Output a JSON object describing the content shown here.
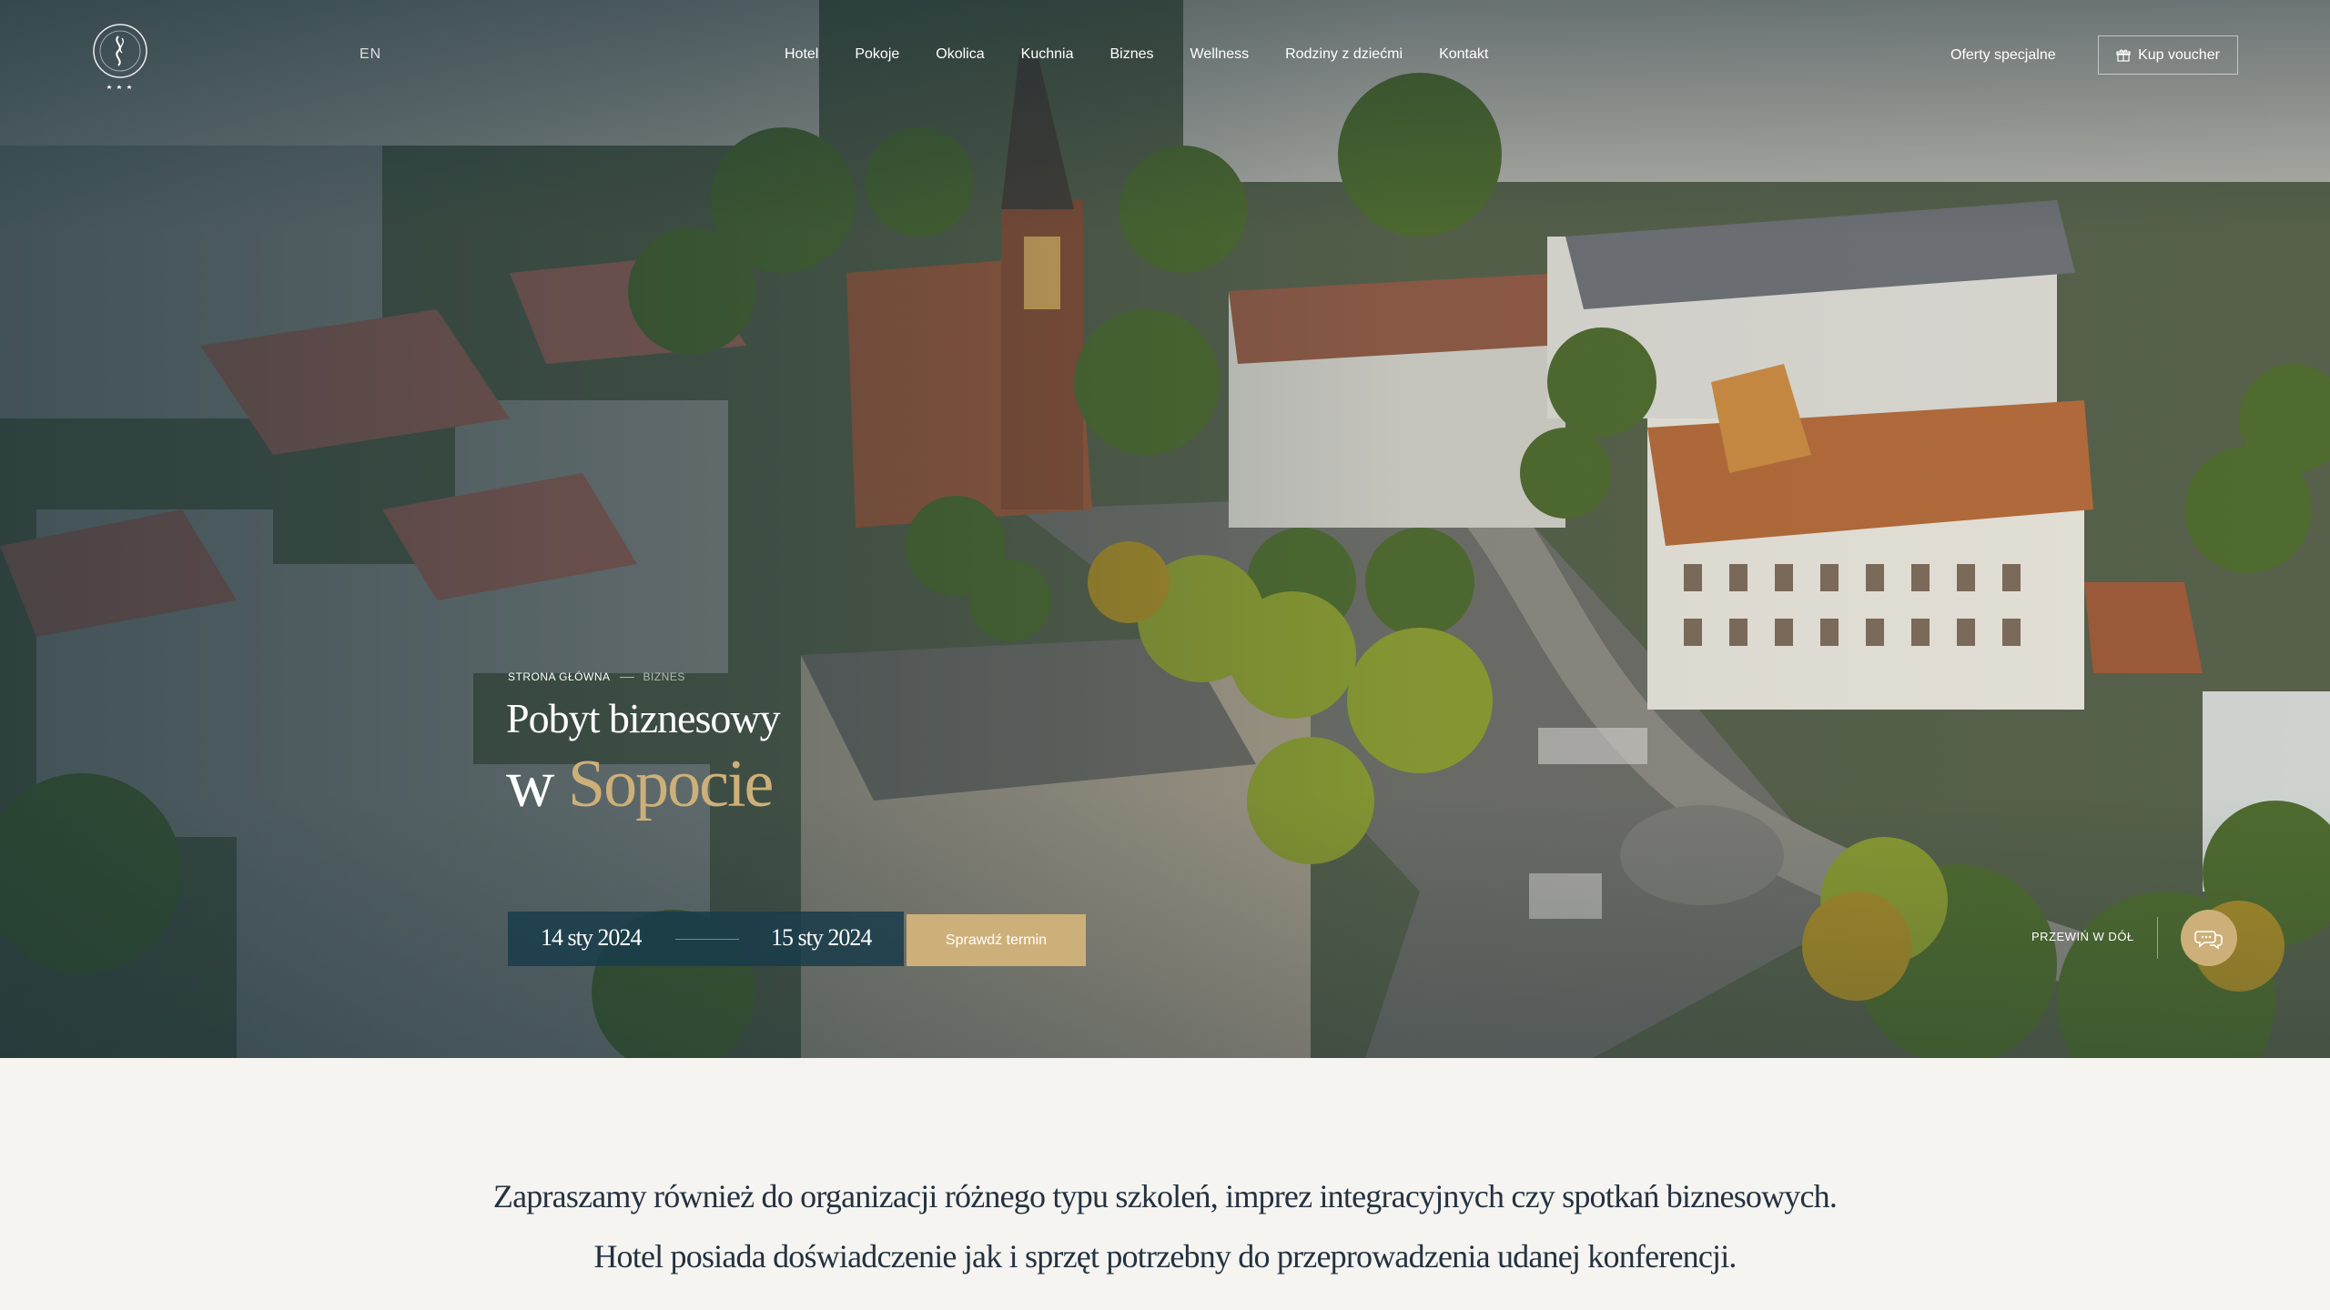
{
  "header": {
    "lang": "EN",
    "nav": [
      "Hotel",
      "Pokoje",
      "Okolica",
      "Kuchnia",
      "Biznes",
      "Wellness",
      "Rodziny z dziećmi",
      "Kontakt"
    ],
    "offers": "Oferty specjalne",
    "voucher": "Kup voucher"
  },
  "hero": {
    "breadcrumb": {
      "home": "STRONA GŁÓWNA",
      "current": "BIZNES"
    },
    "title_line1": "Pobyt biznesowy",
    "title_line2_prefix": "w",
    "title_line2_accent": "Sopocie",
    "booking": {
      "date_from": "14 sty 2024",
      "date_to": "15 sty 2024",
      "check_button": "Sprawdź termin"
    },
    "scroll_label": "PRZEWIŃ W DÓŁ"
  },
  "intro": {
    "line1": "Zapraszamy również do organizacji różnego typu szkoleń, imprez integracyjnych czy spotkań biznesowych.",
    "line2": "Hotel posiada doświadczenie jak i sprzęt potrzebny do przeprowadzenia udanej konferencji."
  },
  "colors": {
    "gold": "#cdb079",
    "navy": "#193c4b",
    "text_dark": "#243240",
    "page_bg": "#f5f4f1"
  }
}
